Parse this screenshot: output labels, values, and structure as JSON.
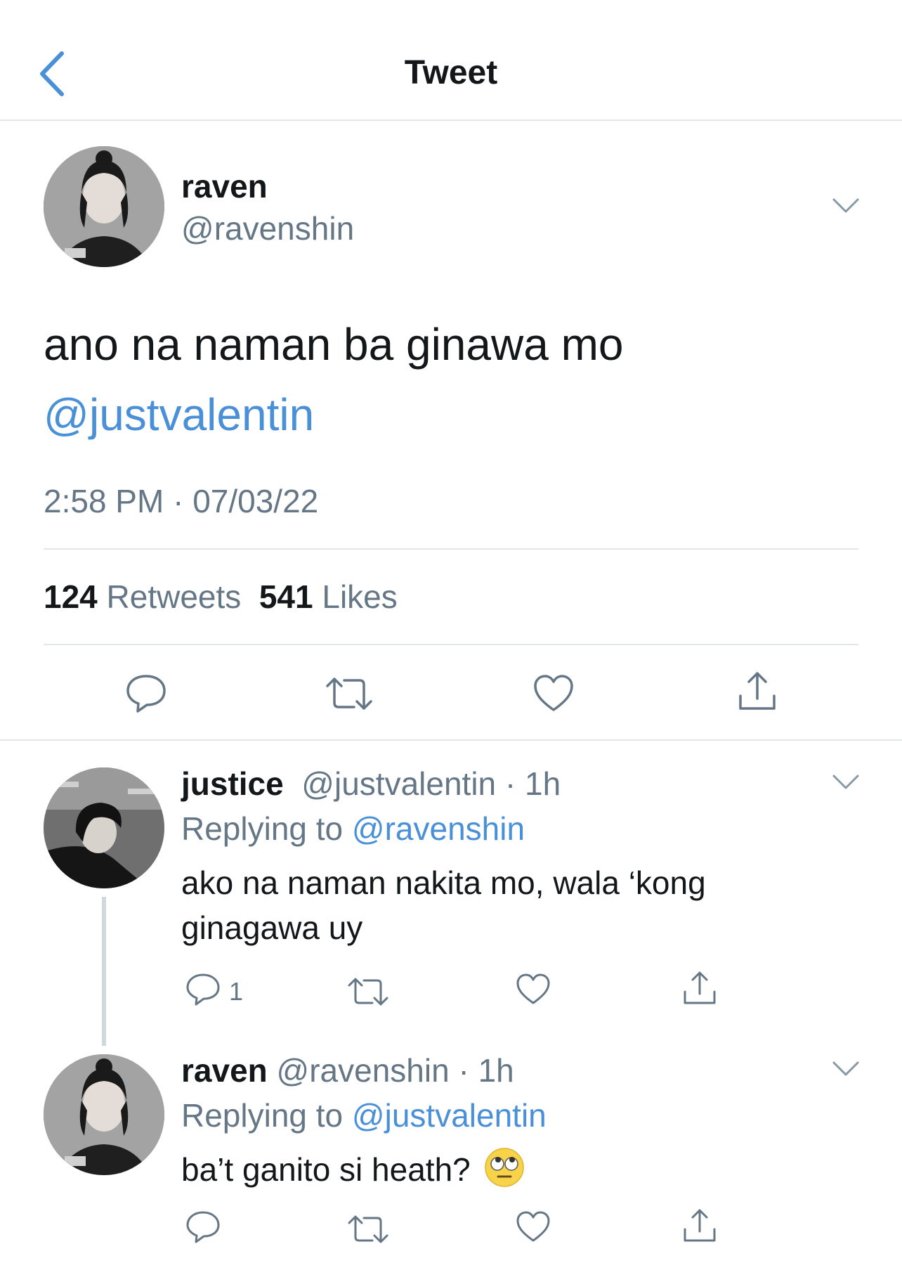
{
  "header": {
    "title": "Tweet"
  },
  "main_tweet": {
    "name": "raven",
    "handle": "@ravenshin",
    "text": "ano na naman ba ginawa mo",
    "mention": "@justvalentin",
    "timestamp": "2:58 PM · 07/03/22",
    "retweets_count": "124",
    "retweets_label": "Retweets",
    "likes_count": "541",
    "likes_label": "Likes"
  },
  "replies": [
    {
      "name": "justice",
      "handle": "@justvalentin",
      "time": "· 1h",
      "replying_label": "Replying to",
      "replying_to": "@ravenshin",
      "text": "ako na naman nakita mo, wala ‘kong ginagawa uy",
      "reply_count": "1"
    },
    {
      "name": "raven",
      "handle": "@ravenshin",
      "time": "· 1h",
      "replying_label": "Replying to",
      "replying_to": "@justvalentin",
      "text": "ba’t ganito si heath?",
      "emoji": "eye-roll-emoji"
    }
  ],
  "colors": {
    "accent": "#4a90d9",
    "muted": "#657786",
    "divider": "#e1e8ed"
  }
}
